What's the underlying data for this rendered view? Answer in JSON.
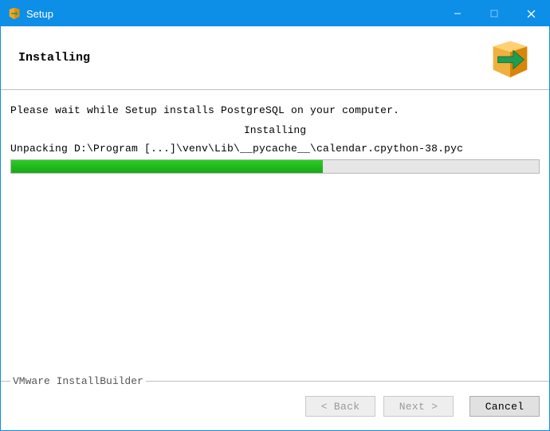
{
  "titlebar": {
    "title": "Setup"
  },
  "header": {
    "title": "Installing"
  },
  "content": {
    "main_message": "Please wait while Setup installs PostgreSQL on your computer.",
    "sub_title": "Installing",
    "current_file": "Unpacking D:\\Program [...]\\venv\\Lib\\__pycache__\\calendar.cpython-38.pyc",
    "progress_percent": 59
  },
  "footer": {
    "brand": "VMware InstallBuilder",
    "back_label": "< Back",
    "next_label": "Next >",
    "cancel_label": "Cancel"
  }
}
